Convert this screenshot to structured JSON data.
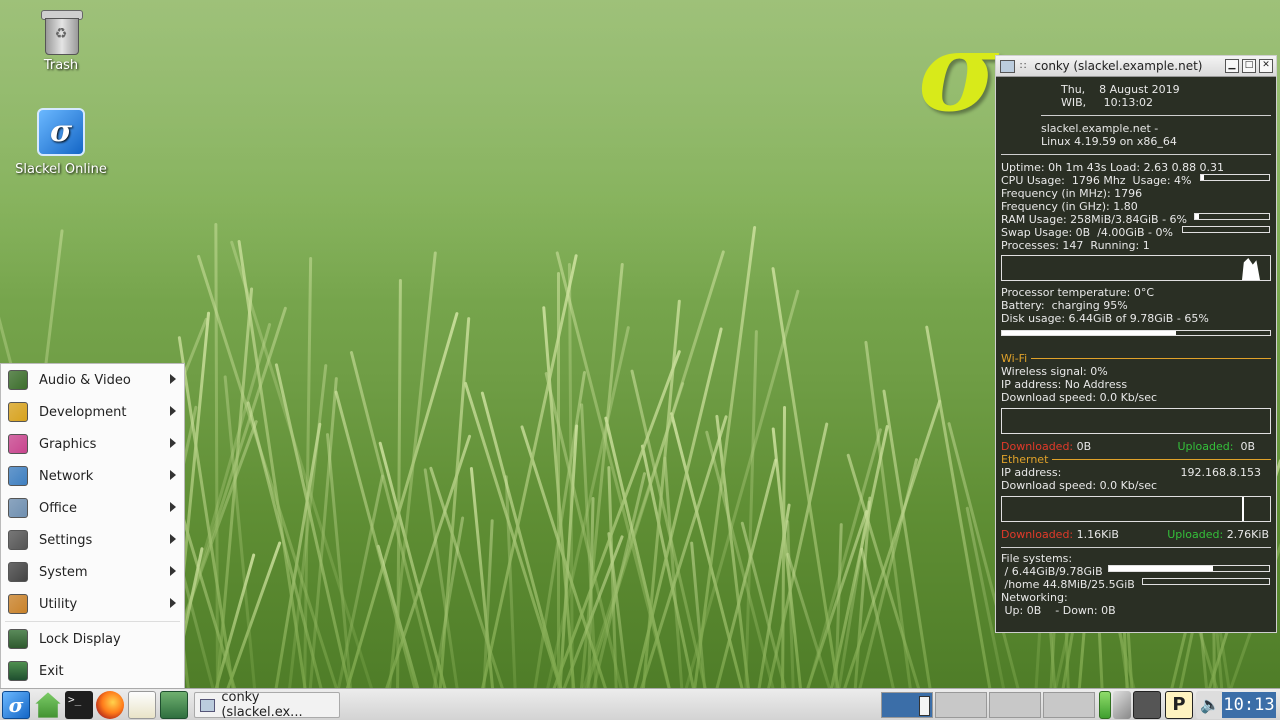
{
  "desktop": {
    "icons": [
      {
        "label": "Trash"
      },
      {
        "label": "Slackel Online",
        "glyph": "σ"
      }
    ],
    "logo_glyph": "σ"
  },
  "conky": {
    "title": "conky (slackel.example.net)",
    "date_line1": "Thu,    8 August 2019",
    "date_line2": "WIB,     10:13:02",
    "host_line1": "slackel.example.net -",
    "host_line2": "Linux 4.19.59 on x86_64",
    "uptime": "Uptime: 0h 1m 43s Load: 2.63 0.88 0.31",
    "cpu_usage": "CPU Usage:  1796 Mhz  Usage: 4%",
    "cpu_pct": 4,
    "freq_mhz": "Frequency (in MHz): 1796",
    "freq_ghz": "Frequency (in GHz): 1.80",
    "ram": "RAM Usage: 258MiB/3.84GiB - 6%",
    "ram_pct": 6,
    "swap": "Swap Usage: 0B  /4.00GiB - 0%",
    "swap_pct": 0,
    "processes": "Processes: 147  Running: 1",
    "temp": "Processor temperature: 0°C",
    "battery": "Battery:  charging 95%",
    "disk": "Disk usage: 6.44GiB of 9.78GiB - 65%",
    "disk_pct": 65,
    "wifi": {
      "title": "Wi-Fi",
      "signal": "Wireless signal: 0%",
      "ip": "IP address: No Address",
      "download_speed": "Download speed: 0.0 Kb/sec",
      "downloaded_label": "Downloaded:",
      "downloaded_value": "0B",
      "uploaded_label": "Uploaded:",
      "uploaded_value": "0B"
    },
    "ethernet": {
      "title": "Ethernet",
      "ip_label": "IP address:",
      "ip_value": "192.168.8.153",
      "download_speed": "Download speed: 0.0 Kb/sec",
      "downloaded_label": "Downloaded:",
      "downloaded_value": "1.16KiB",
      "uploaded_label": "Uploaded:",
      "uploaded_value": "2.76KiB"
    },
    "fs_title": "File systems:",
    "fs_root": " / 6.44GiB/9.78GiB",
    "fs_root_pct": 65,
    "fs_home": " /home 44.8MiB/25.5GiB",
    "fs_home_pct": 0,
    "net_title": "Networking:",
    "net_line": " Up: 0B    - Down: 0B"
  },
  "menu": {
    "items": [
      {
        "label": "Audio & Video",
        "icon": "audio-video-icon",
        "color": "#3c6e2c"
      },
      {
        "label": "Development",
        "icon": "development-icon",
        "color": "#d7a21e"
      },
      {
        "label": "Graphics",
        "icon": "graphics-icon",
        "color": "#c8458e"
      },
      {
        "label": "Network",
        "icon": "network-icon",
        "color": "#3f7fc0"
      },
      {
        "label": "Office",
        "icon": "office-icon",
        "color": "#6f8fb0"
      },
      {
        "label": "Settings",
        "icon": "settings-icon",
        "color": "#555555"
      },
      {
        "label": "System",
        "icon": "system-icon",
        "color": "#444444"
      },
      {
        "label": "Utility",
        "icon": "utility-icon",
        "color": "#c9822a"
      }
    ],
    "lock": "Lock Display",
    "exit": "Exit"
  },
  "taskbar": {
    "task": "conky (slackel.ex...",
    "clock": "10:13",
    "colors": {
      "active_workspace": "#3b6ea8",
      "clock_bg": "#3b6ea8"
    }
  }
}
